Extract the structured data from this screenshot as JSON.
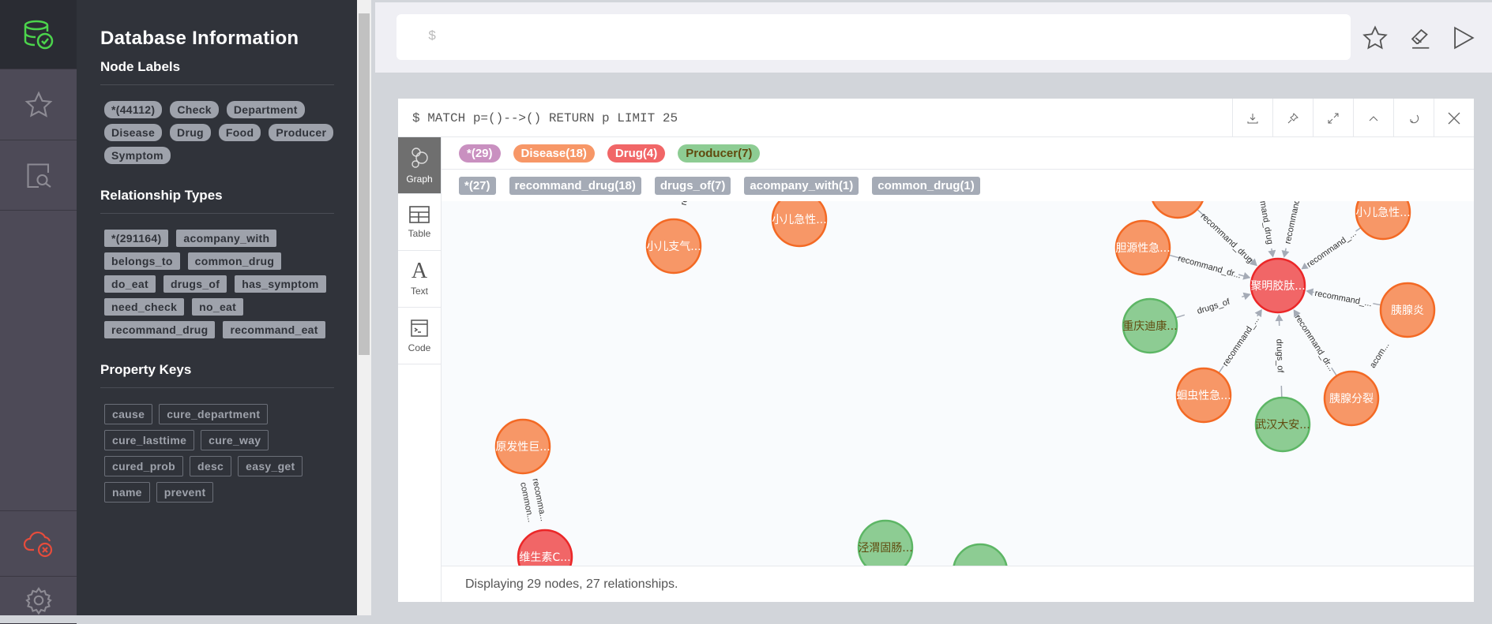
{
  "sidebar": {
    "title": "Database Information",
    "node_labels_heading": "Node Labels",
    "node_labels": [
      "*(44112)",
      "Check",
      "Department",
      "Disease",
      "Drug",
      "Food",
      "Producer",
      "Symptom"
    ],
    "rel_types_heading": "Relationship Types",
    "rel_types": [
      "*(291164)",
      "acompany_with",
      "belongs_to",
      "common_drug",
      "do_eat",
      "drugs_of",
      "has_symptom",
      "need_check",
      "no_eat",
      "recommand_drug",
      "recommand_eat"
    ],
    "property_keys_heading": "Property Keys",
    "property_keys": [
      "cause",
      "cure_department",
      "cure_lasttime",
      "cure_way",
      "cured_prob",
      "desc",
      "easy_get",
      "name",
      "prevent"
    ]
  },
  "iconbar": [
    "database-icon",
    "star-icon",
    "search-docs-icon",
    "disconnected-icon",
    "gear-icon"
  ],
  "editor": {
    "prompt": "$"
  },
  "frame": {
    "query": "$ MATCH p=()-->() RETURN p LIMIT 25",
    "tabs": [
      "Graph",
      "Table",
      "Text",
      "Code"
    ],
    "node_legend": [
      {
        "label": "*(29)",
        "color": "#c990c0",
        "text": "#ffffff"
      },
      {
        "label": "Disease(18)",
        "color": "#f79767",
        "text": "#ffffff"
      },
      {
        "label": "Drug(4)",
        "color": "#f16667",
        "text": "#ffffff"
      },
      {
        "label": "Producer(7)",
        "color": "#8dcc93",
        "text": "#604a0e"
      }
    ],
    "rel_legend": [
      "*(27)",
      "recommand_drug(18)",
      "drugs_of(7)",
      "acompany_with(1)",
      "common_drug(1)"
    ],
    "status": "Displaying 29 nodes, 27 relationships."
  },
  "colors": {
    "Disease": {
      "fill": "#f79767",
      "stroke": "#f36924",
      "text": "#ffffff"
    },
    "Drug": {
      "fill": "#f16667",
      "stroke": "#eb2728",
      "text": "#ffffff"
    },
    "Producer": {
      "fill": "#8dcc93",
      "stroke": "#5db665",
      "text": "#604a0e"
    }
  },
  "graph": {
    "nodes": [
      {
        "id": "n1",
        "label": "小儿支气...",
        "type": "Disease"
      },
      {
        "id": "n2",
        "label": "小儿急性...",
        "type": "Disease"
      },
      {
        "id": "n3",
        "label": "",
        "type": "Disease"
      },
      {
        "id": "n4",
        "label": "胆源性急...",
        "type": "Disease"
      },
      {
        "id": "n5",
        "label": "聚明胶肽...",
        "type": "Drug"
      },
      {
        "id": "n6",
        "label": "小儿急性...",
        "type": "Disease"
      },
      {
        "id": "n7",
        "label": "胰腺炎",
        "type": "Disease"
      },
      {
        "id": "n8",
        "label": "重庆迪康...",
        "type": "Producer"
      },
      {
        "id": "n9",
        "label": "蛔虫性急...",
        "type": "Disease"
      },
      {
        "id": "n10",
        "label": "武汉大安...",
        "type": "Producer"
      },
      {
        "id": "n11",
        "label": "胰腺分裂",
        "type": "Disease"
      },
      {
        "id": "n12",
        "label": "原发性巨...",
        "type": "Disease"
      },
      {
        "id": "n13",
        "label": "维生素C...",
        "type": "Drug"
      },
      {
        "id": "n14",
        "label": "泾渭固肠...",
        "type": "Producer"
      },
      {
        "id": "n15",
        "label": "",
        "type": "Producer"
      }
    ],
    "edges": [
      {
        "from": "n3",
        "to": "n5",
        "label": "recommand_drug"
      },
      {
        "from": "t1",
        "to": "n5",
        "label": "mmand_drug"
      },
      {
        "from": "t2",
        "to": "n5",
        "label": "recommand_"
      },
      {
        "from": "n4",
        "to": "n5",
        "label": "recommand_dr..."
      },
      {
        "from": "n6",
        "to": "n5",
        "label": "recommand_..."
      },
      {
        "from": "n7",
        "to": "n5",
        "label": "recommand_..."
      },
      {
        "from": "n8",
        "to": "n5",
        "label": "drugs_of"
      },
      {
        "from": "n9",
        "to": "n5",
        "label": "recommand_..."
      },
      {
        "from": "n10",
        "to": "n5",
        "label": "drugs_of"
      },
      {
        "from": "n11",
        "to": "n5",
        "label": "recommand_dr..."
      },
      {
        "from": "n11",
        "to": "n7",
        "label": "acom..."
      },
      {
        "from": "n12",
        "to": "n13",
        "label": "recomma..."
      },
      {
        "from": "n12",
        "to": "n13",
        "label": "common..."
      },
      {
        "from": "t3",
        "to": "n1",
        "label": "rec"
      }
    ]
  }
}
